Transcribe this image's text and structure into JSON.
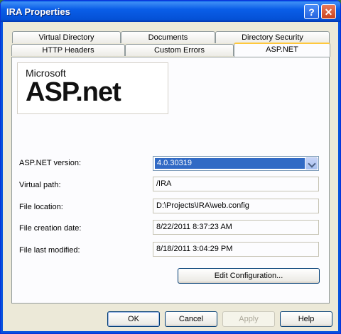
{
  "window": {
    "title": "IRA Properties"
  },
  "titlebar_buttons": {
    "help": "?",
    "close": "✕"
  },
  "tabs_row1": [
    "Virtual Directory",
    "Documents",
    "Directory Security"
  ],
  "tabs_row2": [
    "HTTP Headers",
    "Custom Errors",
    "ASP.NET"
  ],
  "active_tab": "ASP.NET",
  "logo": {
    "brand": "Microsoft",
    "text": "ASP.net"
  },
  "form": {
    "version_label": "ASP.NET version:",
    "version_value": "4.0.30319",
    "vpath_label": "Virtual path:",
    "vpath_value": "/IRA",
    "location_label": "File location:",
    "location_value": "D:\\Projects\\IRA\\web.config",
    "created_label": "File creation date:",
    "created_value": "8/22/2011 8:37:23 AM",
    "modified_label": "File last modified:",
    "modified_value": "8/18/2011 3:04:29 PM"
  },
  "edit_button": "Edit Configuration...",
  "dialog_buttons": {
    "ok": "OK",
    "cancel": "Cancel",
    "apply": "Apply",
    "help": "Help"
  }
}
